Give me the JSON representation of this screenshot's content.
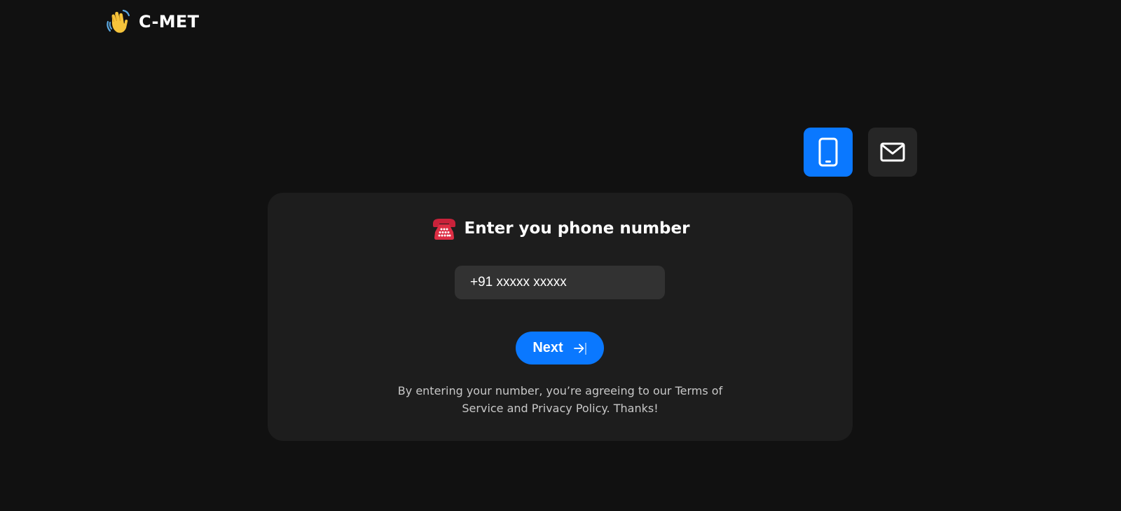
{
  "brand": {
    "name": "C-MET",
    "icon": "waving-hand-icon"
  },
  "mode_toggle": {
    "phone_icon": "smartphone-icon",
    "email_icon": "mail-icon",
    "active": "phone",
    "active_color": "#0a78ff",
    "inactive_color": "#262626"
  },
  "card": {
    "title_icon": "telephone-icon",
    "title": "Enter you phone number",
    "phone_input": {
      "value": "",
      "placeholder": "+91 xxxxx xxxxx"
    },
    "next_button": {
      "label": "Next",
      "icon": "arrow-right-icon"
    },
    "disclaimer_line1": "By entering your number, you’re agreeing to our Terms of",
    "disclaimer_line2": "Service and Privacy Policy. Thanks!"
  },
  "colors": {
    "background": "#111111",
    "card": "#1d1d1d",
    "accent": "#0a78ff",
    "input": "#323232"
  }
}
